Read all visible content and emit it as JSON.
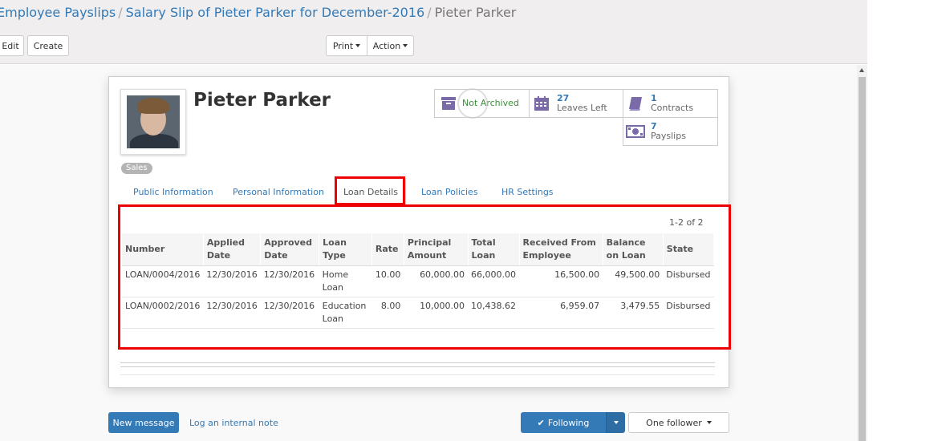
{
  "breadcrumb": {
    "items": [
      "Employee Payslips",
      "Salary Slip of Pieter Parker for December-2016"
    ],
    "current": "Pieter Parker",
    "separator": "/"
  },
  "toolbar": {
    "edit_label": "Edit",
    "create_label": "Create",
    "print_label": "Print",
    "action_label": "Action"
  },
  "employee": {
    "name": "Pieter Parker",
    "tag": "Sales"
  },
  "smart_buttons": {
    "archive": {
      "label": "Not Archived",
      "icon": "archive-icon"
    },
    "leaves": {
      "count": "27",
      "label": "Leaves Left",
      "icon": "calendar-icon"
    },
    "contracts": {
      "count": "1",
      "label": "Contracts",
      "icon": "book-icon"
    },
    "payslips": {
      "count": "7",
      "label": "Payslips",
      "icon": "money-icon"
    }
  },
  "tabs": [
    {
      "label": "Public Information"
    },
    {
      "label": "Personal Information"
    },
    {
      "label": "Loan Details"
    },
    {
      "label": "Loan Policies"
    },
    {
      "label": "HR Settings"
    }
  ],
  "loans": {
    "pager": "1-2 of 2",
    "headers": [
      "Number",
      "Applied Date",
      "Approved Date",
      "Loan Type",
      "Rate",
      "Principal Amount",
      "Total Loan",
      "Received From Employee",
      "Balance on Loan",
      "State"
    ],
    "rows": [
      [
        "LOAN/0004/2016",
        "12/30/2016",
        "12/30/2016",
        "Home Loan",
        "10.00",
        "60,000.00",
        "66,000.00",
        "16,500.00",
        "49,500.00",
        "Disbursed"
      ],
      [
        "LOAN/0002/2016",
        "12/30/2016",
        "12/30/2016",
        "Education Loan",
        "8.00",
        "10,000.00",
        "10,438.62",
        "6,959.07",
        "3,479.55",
        "Disbursed"
      ]
    ]
  },
  "chatter": {
    "new_message": "New message",
    "log_note": "Log an internal note",
    "following": "Following",
    "followers": "One follower"
  },
  "colors": {
    "accent": "#337ab7",
    "primary_button": "#337ab7",
    "highlight": "#e00000",
    "archive_green": "#3a8f3a"
  }
}
